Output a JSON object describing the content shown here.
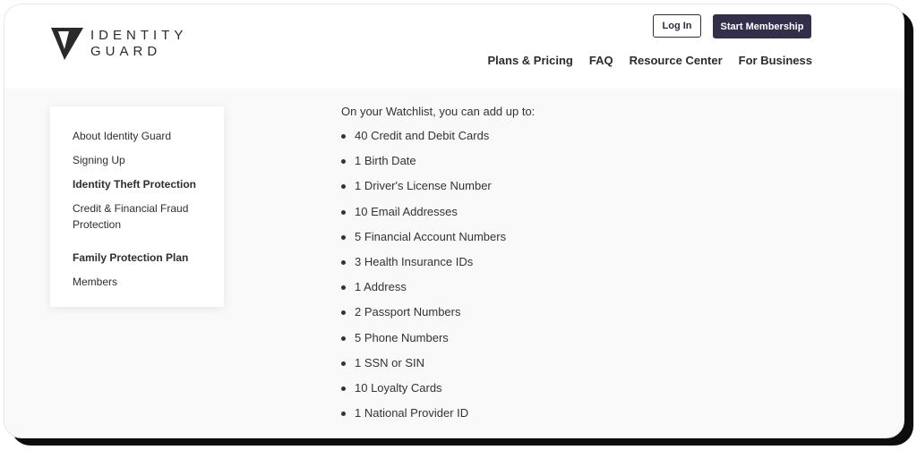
{
  "header": {
    "logo_line1": "IDENTITY",
    "logo_line2": "GUARD",
    "login_label": "Log In",
    "start_label": "Start Membership",
    "nav": [
      "Plans & Pricing",
      "FAQ",
      "Resource Center",
      "For Business"
    ]
  },
  "sidebar": {
    "items": [
      {
        "label": "About Identity Guard",
        "bold": false
      },
      {
        "label": "Signing Up",
        "bold": false
      },
      {
        "label": "Identity Theft Protection",
        "bold": true
      },
      {
        "label": "Credit & Financial Fraud Protection",
        "bold": false
      },
      {
        "label": "Family Protection Plan",
        "bold": true
      },
      {
        "label": "Members",
        "bold": false
      }
    ]
  },
  "main": {
    "intro": "On your Watchlist, you can add up to:",
    "watchlist": [
      "40 Credit and Debit Cards",
      "1 Birth Date",
      "1 Driver's License Number",
      "10 Email Addresses",
      "5 Financial Account Numbers",
      "3 Health Insurance IDs",
      "1 Address",
      "2 Passport Numbers",
      "5 Phone Numbers",
      "1 SSN or SIN",
      "10 Loyalty Cards",
      "1 National Provider ID"
    ]
  },
  "colors": {
    "brand_dark": "#332f4a",
    "text": "#333333",
    "page_bg": "#f9f9f9"
  }
}
